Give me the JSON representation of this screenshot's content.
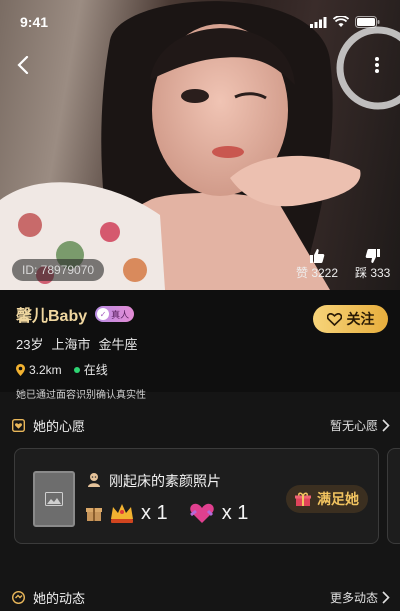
{
  "status_bar": {
    "time": "9:41"
  },
  "profile": {
    "id_label": "ID: 78979070",
    "likes_label": "赞 3222",
    "dislikes_label": "踩 333",
    "name": "馨儿Baby",
    "real_badge": "真人",
    "age": "23岁",
    "city": "上海市",
    "zodiac": "金牛座",
    "distance": "3.2km",
    "online": "在线",
    "verify_text": "她已通过面容识别确认真实性",
    "follow_label": "关注"
  },
  "wish_section": {
    "title": "她的心愿",
    "link": "暂无心愿",
    "item_title": "刚起床的素颜照片",
    "gifts": [
      {
        "icon": "crown-gift-icon",
        "count": "x 1"
      },
      {
        "icon": "heart-gift-icon",
        "count": "x 1"
      }
    ],
    "satisfy_label": "满足她"
  },
  "moments_section": {
    "title": "她的动态",
    "link": "更多动态"
  },
  "colors": {
    "accent_gold": "#f0d7a0",
    "follow_gold": "#e7ae3d",
    "online_green": "#2ed573",
    "background": "#0f0f0f"
  }
}
